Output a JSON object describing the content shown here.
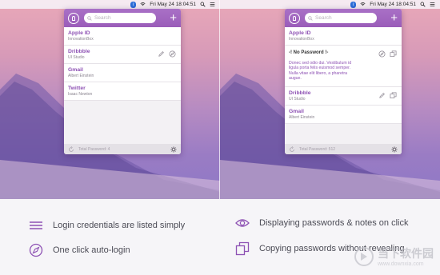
{
  "menubar": {
    "clock": "Fri May 24  18:04:51"
  },
  "app": {
    "search_placeholder": "Search"
  },
  "left_panel": {
    "items": [
      {
        "title": "Apple ID",
        "subtitle": "InnovationBox"
      },
      {
        "title": "Dribbble",
        "subtitle": "UI Studio"
      },
      {
        "title": "Gmail",
        "subtitle": "Albert Einstein"
      },
      {
        "title": "Twitter",
        "subtitle": "Isaac Newton"
      }
    ],
    "footer": "Total Password: 4"
  },
  "right_panel": {
    "items_top": [
      {
        "title": "Apple ID",
        "subtitle": "InnovationBox"
      }
    ],
    "expanded": {
      "title": "-! No Password !-",
      "note": "Donec sed odio dui. Vestibulum id ligula porta felis euismod semper. Nulla vitae elit libero, a pharetra augue."
    },
    "items_bottom": [
      {
        "title": "Dribbble",
        "subtitle": "UI Studio"
      },
      {
        "title": "Gmail",
        "subtitle": "Albert Einstein"
      }
    ],
    "footer": "Total Password: 512"
  },
  "captions": {
    "listed": "Login credentials are listed simply",
    "autologin": "One click auto-login",
    "display": "Displaying passwords & notes on click",
    "copy": "Copying passwords without revealing"
  },
  "watermark": {
    "name": "当下软件园",
    "url": "www.downxia.com"
  },
  "colors": {
    "accent": "#9a5db9",
    "wallpaper_top": "#e9a8b8",
    "wallpaper_bottom": "#8e78c6"
  }
}
